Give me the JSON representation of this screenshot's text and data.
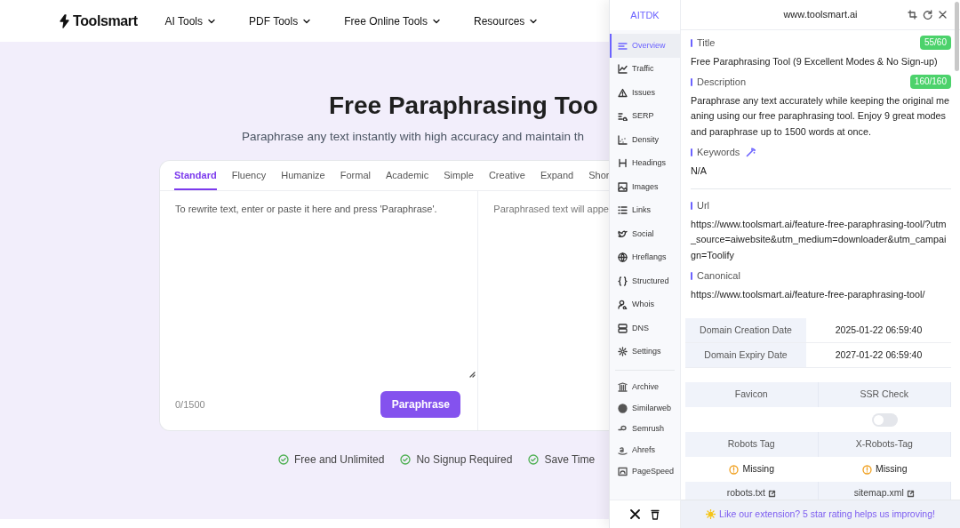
{
  "header": {
    "logo": "Toolsmart",
    "nav": [
      {
        "label": "AI Tools"
      },
      {
        "label": "PDF Tools"
      },
      {
        "label": "Free Online Tools"
      },
      {
        "label": "Resources"
      }
    ]
  },
  "hero": {
    "title": "Free Paraphrasing Too",
    "subtitle": "Paraphrase any text instantly with high accuracy and maintain th"
  },
  "tool": {
    "tabs": [
      {
        "label": "Standard",
        "selected": true
      },
      {
        "label": "Fluency",
        "selected": false
      },
      {
        "label": "Humanize",
        "selected": false
      },
      {
        "label": "Formal",
        "selected": false
      },
      {
        "label": "Academic",
        "selected": false
      },
      {
        "label": "Simple",
        "selected": false
      },
      {
        "label": "Creative",
        "selected": false
      },
      {
        "label": "Expand",
        "selected": false
      },
      {
        "label": "Shor",
        "selected": false
      }
    ],
    "input_placeholder": "To rewrite text, enter or paste it here and press 'Paraphrase'.",
    "output_placeholder": "Paraphrased text will appe",
    "counter": "0/1500",
    "button": "Paraphrase"
  },
  "features": [
    "Free and Unlimited",
    "No Signup Required",
    "Save Time"
  ],
  "extension": {
    "brand": "AITDK",
    "domain": "www.toolsmart.ai",
    "sidebar": [
      {
        "label": "Overview",
        "selected": true
      },
      {
        "label": "Traffic",
        "selected": false
      },
      {
        "label": "Issues",
        "selected": false
      },
      {
        "label": "SERP",
        "selected": false
      },
      {
        "label": "Density",
        "selected": false
      },
      {
        "label": "Headings",
        "selected": false
      },
      {
        "label": "Images",
        "selected": false
      },
      {
        "label": "Links",
        "selected": false
      },
      {
        "label": "Social",
        "selected": false
      },
      {
        "label": "Hreflangs",
        "selected": false
      },
      {
        "label": "Structured",
        "selected": false
      },
      {
        "label": "Whois",
        "selected": false
      },
      {
        "label": "DNS",
        "selected": false
      },
      {
        "label": "Settings",
        "selected": false
      }
    ],
    "sidebar_links": [
      "Archive",
      "Similarweb",
      "Semrush",
      "Ahrefs",
      "PageSpeed"
    ],
    "fields": [
      {
        "label": "Title",
        "badge": "55/60",
        "value": "Free Paraphrasing Tool (9 Excellent Modes & No Sign-up)"
      },
      {
        "label": "Description",
        "badge": "160/160",
        "value": "Paraphrase any text accurately while keeping the original meaning using our free paraphrasing tool. Enjoy 9 great modes and paraphrase up to 1500 words at once."
      },
      {
        "label": "Keywords",
        "kind": "wand",
        "value": "N/A"
      },
      {
        "kind": "divider",
        "label": "Url",
        "value": "https://www.toolsmart.ai/feature-free-paraphrasing-tool/?utm_source=aiwebsite&utm_medium=downloader&utm_campaign=Toolify"
      },
      {
        "label": "Canonical",
        "value": "https://www.toolsmart.ai/feature-free-paraphrasing-tool/"
      }
    ],
    "domain_table": [
      {
        "label": "Domain Creation Date",
        "value": "2025-01-22 06:59:40"
      },
      {
        "label": "Domain Expiry Date",
        "value": "2027-01-22 06:59:40"
      }
    ],
    "checks": [
      {
        "label": "Favicon",
        "kind": "empty"
      },
      {
        "label": "SSR Check",
        "kind": "toggle",
        "on": false
      },
      {
        "label": "Robots Tag",
        "kind": "status",
        "status": "Missing"
      },
      {
        "label": "X-Robots-Tag",
        "kind": "status",
        "status": "Missing"
      }
    ],
    "links": [
      "robots.txt",
      "sitemap.xml"
    ],
    "banner": "Like our extension? 5 star rating helps us improving!"
  }
}
